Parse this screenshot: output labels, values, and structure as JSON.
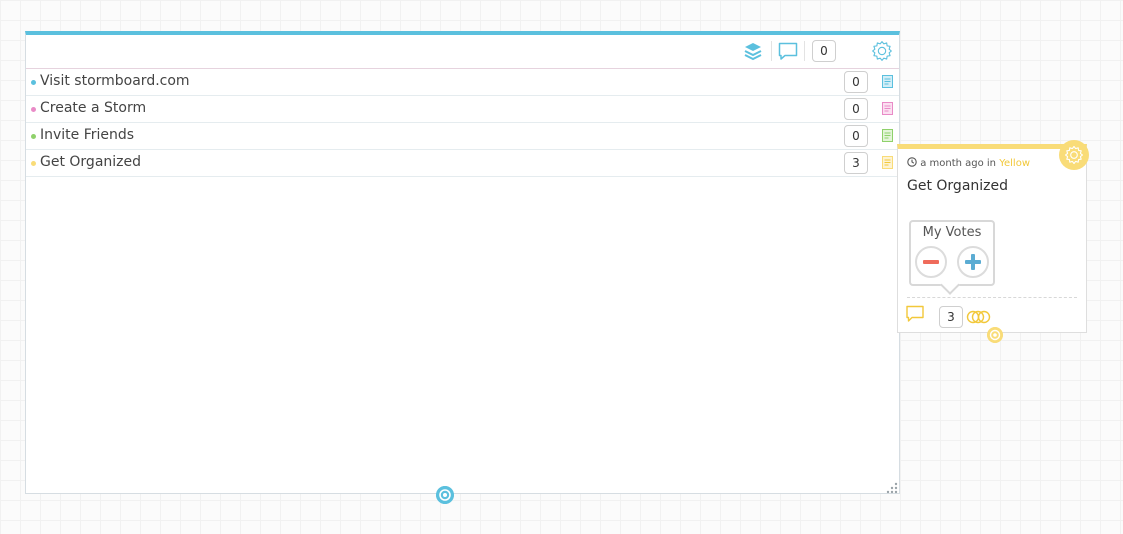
{
  "panel": {
    "accent_color": "#5bc0de",
    "toolbar": {
      "icons": [
        "layers-icon",
        "comment-icon",
        "gear-icon"
      ],
      "comment_count": "0"
    },
    "items": [
      {
        "label": "Visit stormboard.com",
        "count": "0",
        "color": "#5bc0de"
      },
      {
        "label": "Create a Storm",
        "count": "0",
        "color": "#e98bc7"
      },
      {
        "label": "Invite Friends",
        "count": "0",
        "color": "#8fd16b"
      },
      {
        "label": "Get Organized",
        "count": "3",
        "color": "#f9dc78"
      }
    ]
  },
  "card": {
    "color": "#f9dc78",
    "time_text": "a month ago in",
    "color_tag": "Yellow",
    "title": "Get Organized",
    "votes_label": "My Votes",
    "vote_count": "3",
    "icons": [
      "clock-icon",
      "gear-icon",
      "minus-icon",
      "plus-icon",
      "comment-icon",
      "link-icon"
    ]
  }
}
